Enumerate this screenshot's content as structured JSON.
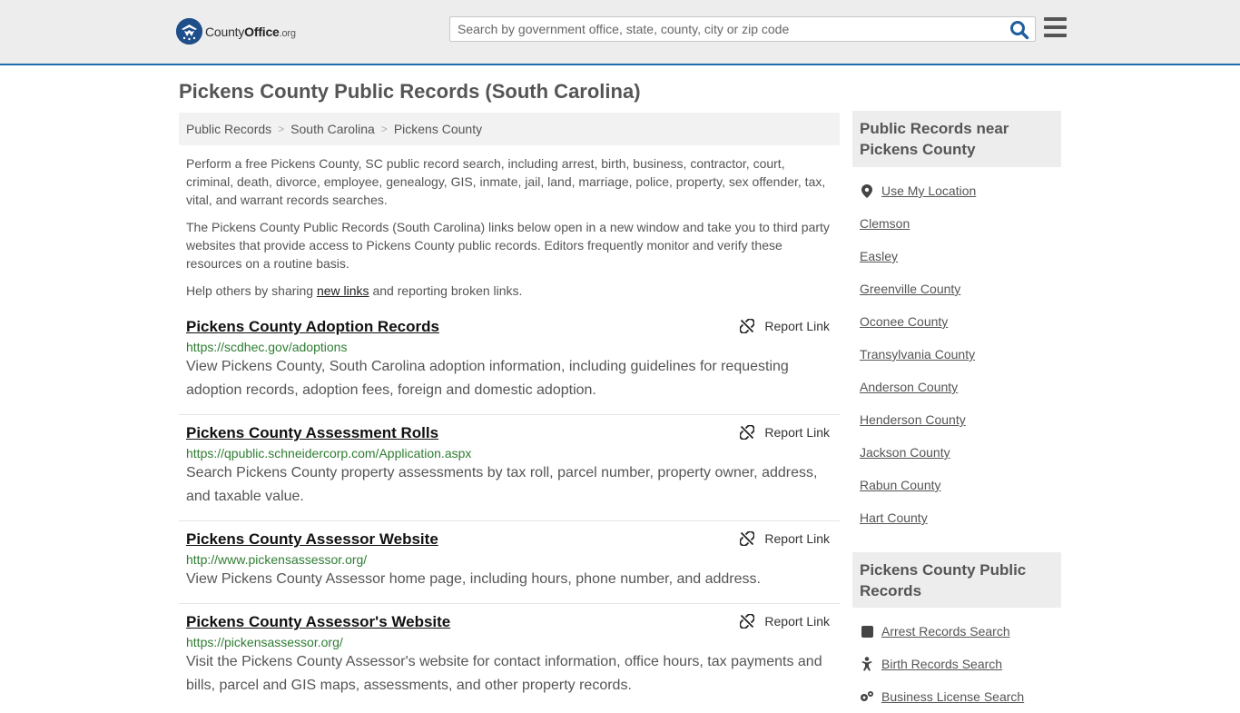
{
  "header": {
    "logo_main": "County",
    "logo_bold": "Office",
    "logo_org": ".org",
    "search_placeholder": "Search by government office, state, county, city or zip code"
  },
  "page": {
    "title": "Pickens County Public Records (South Carolina)"
  },
  "breadcrumb": [
    "Public Records",
    "South Carolina",
    "Pickens County"
  ],
  "intro": {
    "p1": "Perform a free Pickens County, SC public record search, including arrest, birth, business, contractor, court, criminal, death, divorce, employee, genealogy, GIS, inmate, jail, land, marriage, police, property, sex offender, tax, vital, and warrant records searches.",
    "p2": "The Pickens County Public Records (South Carolina) links below open in a new window and take you to third party websites that provide access to Pickens County public records. Editors frequently monitor and verify these resources on a routine basis.",
    "p3_before": "Help others by sharing ",
    "p3_link": "new links",
    "p3_after": " and reporting broken links."
  },
  "report_label": "Report Link",
  "records": [
    {
      "title": "Pickens County Adoption Records",
      "url": "https://scdhec.gov/adoptions",
      "desc": "View Pickens County, South Carolina adoption information, including guidelines for requesting adoption records, adoption fees, foreign and domestic adoption."
    },
    {
      "title": "Pickens County Assessment Rolls",
      "url": "https://qpublic.schneidercorp.com/Application.aspx",
      "desc": "Search Pickens County property assessments by tax roll, parcel number, property owner, address, and taxable value."
    },
    {
      "title": "Pickens County Assessor Website",
      "url": "http://www.pickensassessor.org/",
      "desc": "View Pickens County Assessor home page, including hours, phone number, and address."
    },
    {
      "title": "Pickens County Assessor's Website",
      "url": "https://pickensassessor.org/",
      "desc": "Visit the Pickens County Assessor's website for contact information, office hours, tax payments and bills, parcel and GIS maps, assessments, and other property records."
    }
  ],
  "sidebar": {
    "nearby_heading": "Public Records near Pickens County",
    "use_location": "Use My Location",
    "nearby": [
      "Clemson",
      "Easley",
      "Greenville County",
      "Oconee County",
      "Transylvania County",
      "Anderson County",
      "Henderson County",
      "Jackson County",
      "Rabun County",
      "Hart County"
    ],
    "records_heading": "Pickens County Public Records",
    "record_links": [
      {
        "label": "Arrest Records Search",
        "icon": "square-icon"
      },
      {
        "label": "Birth Records Search",
        "icon": "baby-icon"
      },
      {
        "label": "Business License Search",
        "icon": "gears-icon"
      }
    ]
  },
  "colors": {
    "accent": "#1f6cb0",
    "url_green": "#2e7d32",
    "header_bg": "#ededed"
  }
}
